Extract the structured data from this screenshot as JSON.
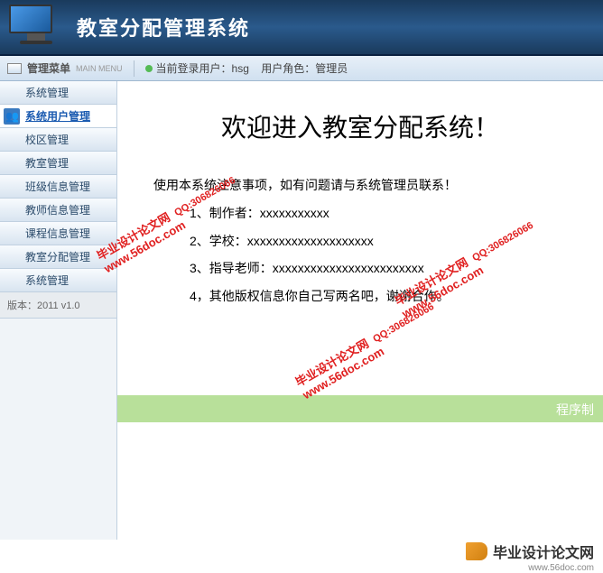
{
  "header": {
    "title": "教室分配管理系统"
  },
  "toolbar": {
    "menu_label": "管理菜单",
    "menu_sublabel": "MAIN MENU",
    "status_prefix": "当前登录用户：",
    "username": "hsg",
    "role_prefix": "用户角色：",
    "role": "管理员"
  },
  "sidebar": {
    "items": [
      {
        "label": "系统管理"
      },
      {
        "label": "系统用户管理"
      },
      {
        "label": "校区管理"
      },
      {
        "label": "教室管理"
      },
      {
        "label": "班级信息管理"
      },
      {
        "label": "教师信息管理"
      },
      {
        "label": "课程信息管理"
      },
      {
        "label": "教室分配管理"
      },
      {
        "label": "系统管理"
      }
    ],
    "version": "版本：2011 v1.0"
  },
  "content": {
    "welcome": "欢迎进入教室分配系统！",
    "notice_intro": "使用本系统注意事项，如有问题请与系统管理员联系！",
    "line1": "1、制作者：xxxxxxxxxxx",
    "line2": "2、学校：xxxxxxxxxxxxxxxxxxxx",
    "line3": "3、指导老师：xxxxxxxxxxxxxxxxxxxxxxxx",
    "line4": "4，其他版权信息你自己写两名吧，谢谢合作。",
    "footer_bar": "程序制"
  },
  "watermark": {
    "site": "www.56doc.com",
    "brand": "毕业设计论文网",
    "qq": "QQ:306826066"
  },
  "footer": {
    "brand": "毕业设计论文网",
    "url": "www.56doc.com"
  }
}
